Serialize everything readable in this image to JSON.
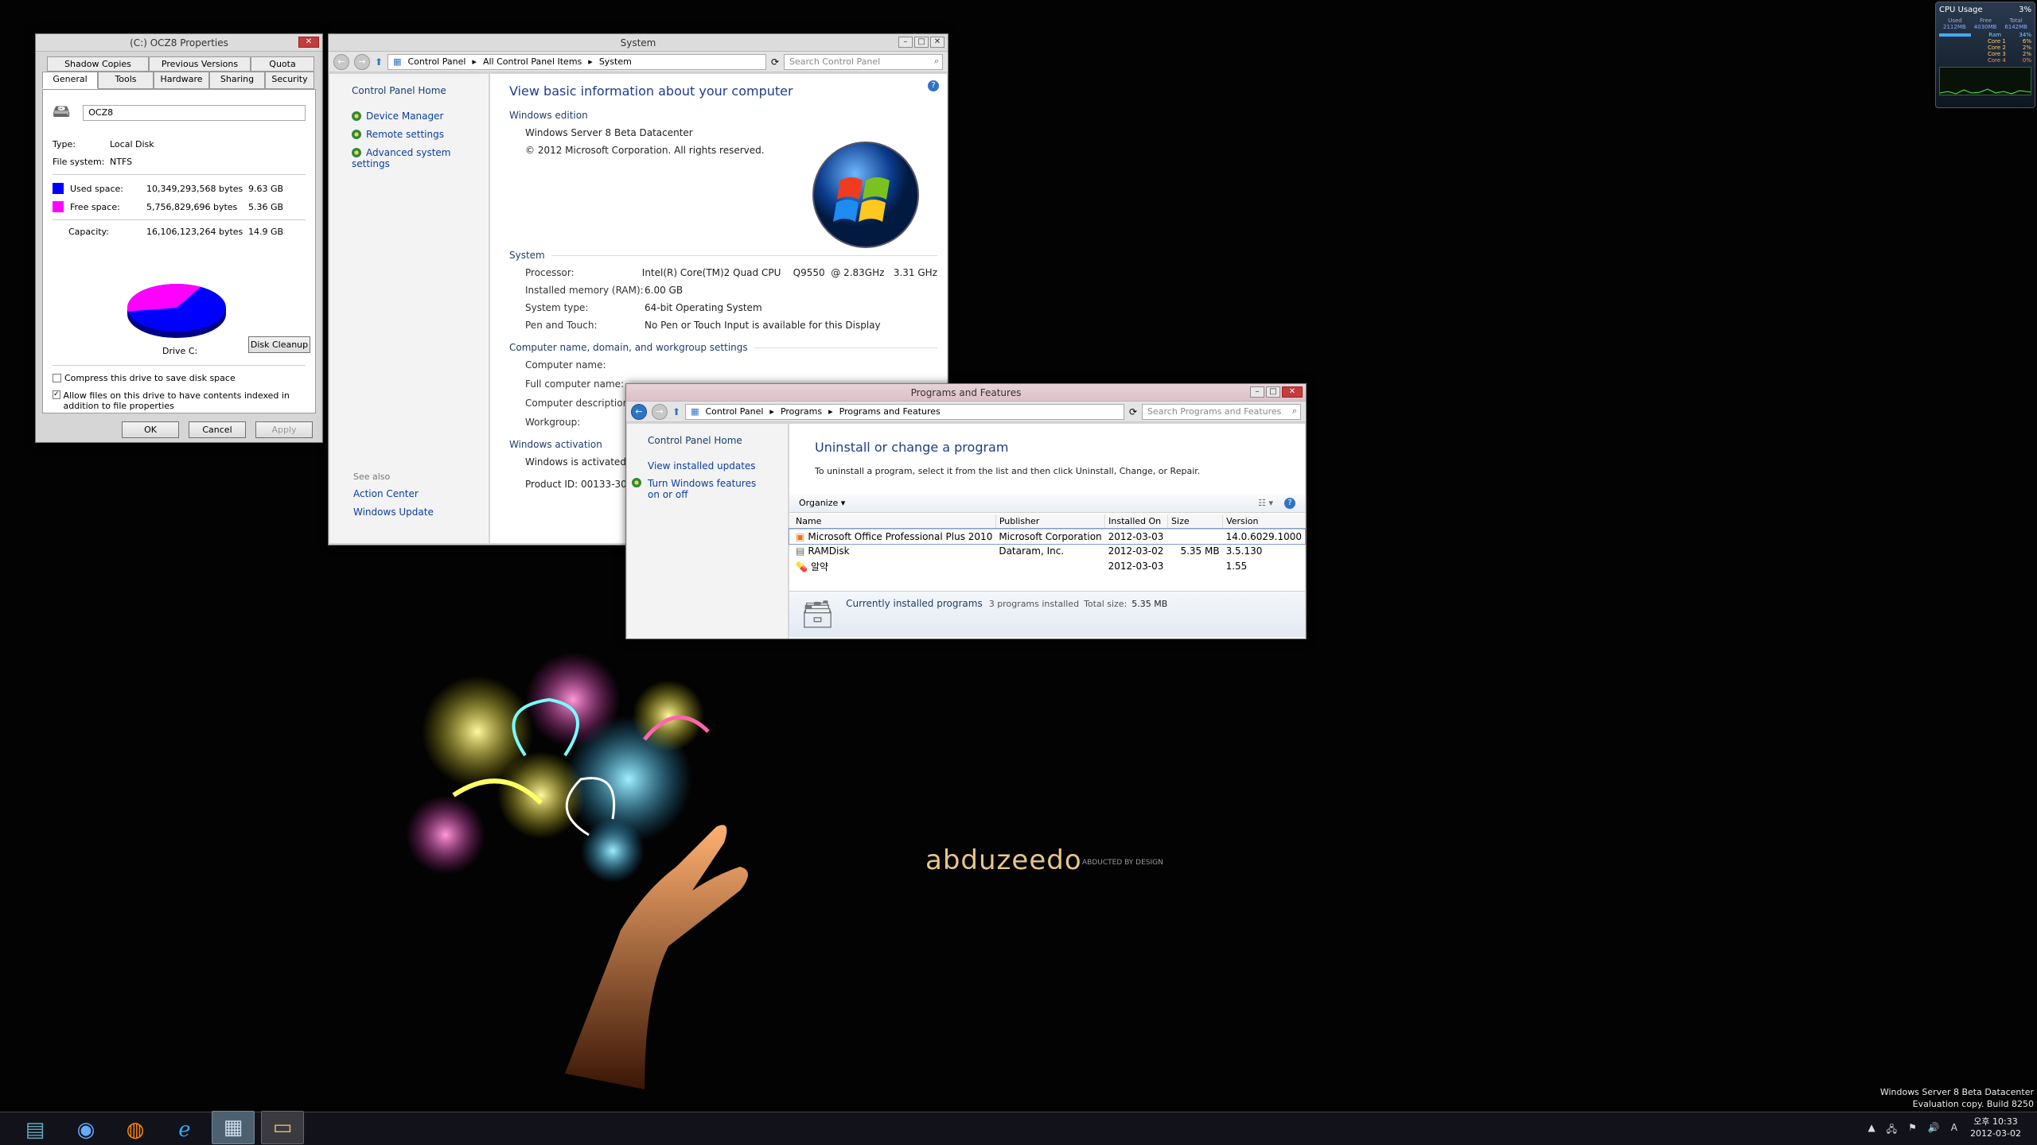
{
  "colors": {
    "accent": "#2f74c4",
    "used": "#0000ff",
    "free": "#ff00ff",
    "link": "#0b3ea0"
  },
  "props": {
    "title": "(C:) OCZ8 Properties",
    "tabs_top": [
      "Shadow Copies",
      "Previous Versions",
      "Quota"
    ],
    "tabs_bottom": [
      "General",
      "Tools",
      "Hardware",
      "Sharing",
      "Security"
    ],
    "drive_name": "OCZ8",
    "type_label": "Type:",
    "type_value": "Local Disk",
    "fs_label": "File system:",
    "fs_value": "NTFS",
    "used_label": "Used space:",
    "used_bytes": "10,349,293,568 bytes",
    "used_gb": "9.63 GB",
    "free_label": "Free space:",
    "free_bytes": "5,756,829,696 bytes",
    "free_gb": "5.36 GB",
    "cap_label": "Capacity:",
    "cap_bytes": "16,106,123,264 bytes",
    "cap_gb": "14.9 GB",
    "used_fraction": 0.643,
    "drive_caption": "Drive C:",
    "cleanup": "Disk Cleanup",
    "compress": "Compress this drive to save disk space",
    "index": "Allow files on this drive to have contents indexed in addition to file properties",
    "ok": "OK",
    "cancel": "Cancel",
    "apply": "Apply"
  },
  "system": {
    "title": "System",
    "crumbs": [
      "Control Panel",
      "All Control Panel Items",
      "System"
    ],
    "search": "Search Control Panel",
    "left_home": "Control Panel Home",
    "left_links": [
      "Device Manager",
      "Remote settings",
      "Advanced system settings"
    ],
    "see_also": "See also",
    "see_also_links": [
      "Action Center",
      "Windows Update"
    ],
    "heading": "View basic information about your computer",
    "edition_section": "Windows edition",
    "edition": "Windows Server 8 Beta Datacenter",
    "copyright": "© 2012 Microsoft Corporation. All rights reserved.",
    "system_section": "System",
    "system_rows": [
      {
        "k": "Processor:",
        "v": "Intel(R) Core(TM)2 Quad CPU    Q9550  @ 2.83GHz   3.31 GHz"
      },
      {
        "k": "Installed memory (RAM):",
        "v": "6.00 GB"
      },
      {
        "k": "System type:",
        "v": "64-bit Operating System"
      },
      {
        "k": "Pen and Touch:",
        "v": "No Pen or Touch Input is available for this Display"
      }
    ],
    "comp_section": "Computer name, domain, and workgroup settings",
    "comp_rows": [
      "Computer name:",
      "Full computer name:",
      "Computer description:",
      "Workgroup:"
    ],
    "act_section": "Windows activation",
    "activated": "Windows is activated",
    "product_id": "Product ID: 00133-30010"
  },
  "programs": {
    "title": "Programs and Features",
    "crumbs": [
      "Control Panel",
      "Programs",
      "Programs and Features"
    ],
    "search": "Search Programs and Features",
    "left_home": "Control Panel Home",
    "left_links": [
      "View installed updates",
      "Turn Windows features on or off"
    ],
    "heading": "Uninstall or change a program",
    "desc": "To uninstall a program, select it from the list and then click Uninstall, Change, or Repair.",
    "organize": "Organize",
    "columns": [
      "Name",
      "Publisher",
      "Installed On",
      "Size",
      "Version"
    ],
    "rows": [
      {
        "name": "Microsoft Office Professional Plus 2010",
        "publisher": "Microsoft Corporation",
        "date": "2012-03-03",
        "size": "",
        "version": "14.0.6029.1000"
      },
      {
        "name": "RAMDisk",
        "publisher": "Dataram, Inc.",
        "date": "2012-03-02",
        "size": "5.35 MB",
        "version": "3.5.130"
      },
      {
        "name": "알약",
        "publisher": "",
        "date": "2012-03-03",
        "size": "",
        "version": "1.55"
      }
    ],
    "status_title": "Currently installed programs",
    "status_count": "3 programs installed",
    "status_size_label": "Total size:",
    "status_size": "5.35 MB"
  },
  "gadget": {
    "title": "CPU Usage",
    "percent": "3%",
    "headers": [
      "Used",
      "Free",
      "Total"
    ],
    "mem": [
      "2112MB",
      "4030MB",
      "6142MB"
    ],
    "rows": [
      {
        "k": "Ram",
        "v": "34%"
      },
      {
        "k": "Core 1",
        "v": "6%"
      },
      {
        "k": "Core 2",
        "v": "2%"
      },
      {
        "k": "Core 3",
        "v": "2%"
      },
      {
        "k": "Core 4",
        "v": "0%"
      }
    ]
  },
  "wallpaper": {
    "brand": "abduzeedo",
    "tagline": "ABDUCTED BY DESIGN"
  },
  "watermark": {
    "line1": "Windows Server 8 Beta Datacenter",
    "line2": "Evaluation copy. Build 8250"
  },
  "taskbar": {
    "apps": [
      "server-manager-icon",
      "globe-icon",
      "firefox-icon",
      "internet-explorer-icon",
      "control-panel-icon",
      "file-explorer-icon"
    ],
    "time": "오후 10:33",
    "date": "2012-03-02",
    "ime": "A"
  }
}
